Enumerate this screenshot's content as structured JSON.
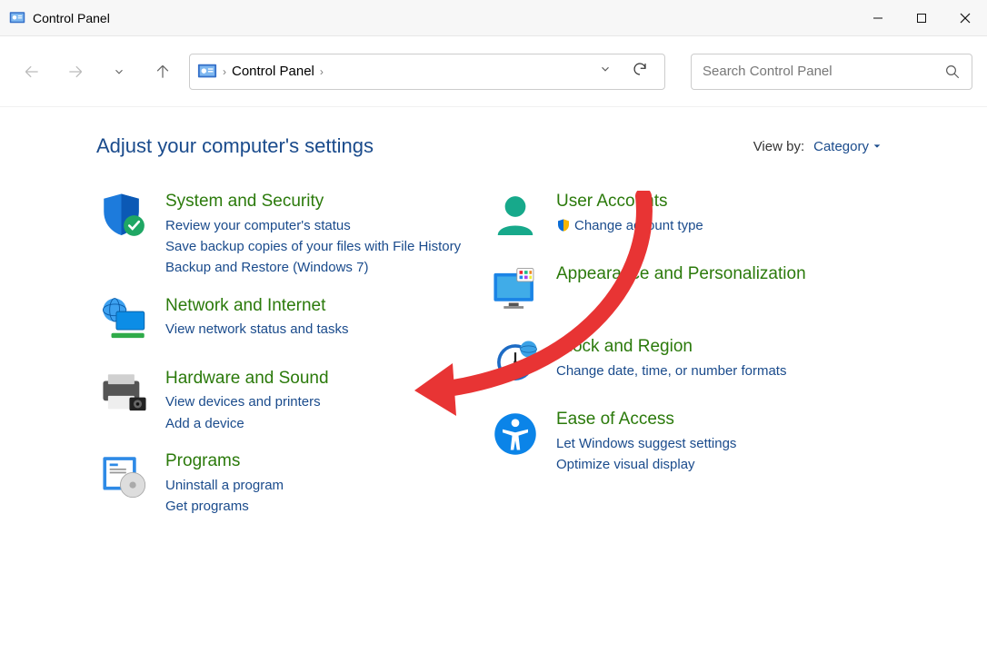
{
  "window": {
    "title": "Control Panel"
  },
  "toolbar": {
    "breadcrumb": "Control Panel",
    "search_placeholder": "Search Control Panel"
  },
  "heading": "Adjust your computer's settings",
  "viewby": {
    "label": "View by:",
    "value": "Category"
  },
  "left_categories": [
    {
      "title": "System and Security",
      "links": [
        "Review your computer's status",
        "Save backup copies of your files with File History",
        "Backup and Restore (Windows 7)"
      ]
    },
    {
      "title": "Network and Internet",
      "links": [
        "View network status and tasks"
      ]
    },
    {
      "title": "Hardware and Sound",
      "links": [
        "View devices and printers",
        "Add a device"
      ]
    },
    {
      "title": "Programs",
      "links": [
        "Uninstall a program",
        "Get programs"
      ]
    }
  ],
  "right_categories": [
    {
      "title": "User Accounts",
      "links": [
        "Change account type"
      ],
      "shield_on_link": 0
    },
    {
      "title": "Appearance and Personalization",
      "links": []
    },
    {
      "title": "Clock and Region",
      "links": [
        "Change date, time, or number formats"
      ]
    },
    {
      "title": "Ease of Access",
      "links": [
        "Let Windows suggest settings",
        "Optimize visual display"
      ]
    }
  ]
}
